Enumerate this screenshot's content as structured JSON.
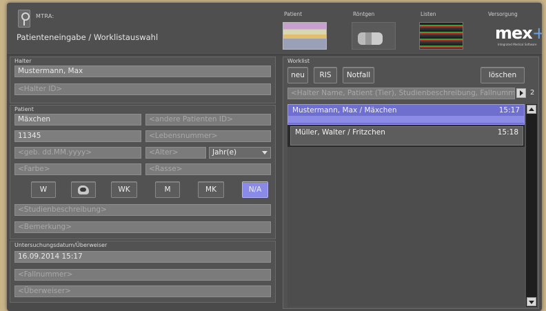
{
  "header": {
    "app_name": "MTRA:",
    "page_title": "Patienteneingabe / Worklistauswahl",
    "tabs": [
      {
        "label": "Patient",
        "icon": "patient-form-thumbnail"
      },
      {
        "label": "Röntgen",
        "icon": "xray-thumbnail"
      },
      {
        "label": "Listen",
        "icon": "list-thumbnail"
      },
      {
        "label": "Versorgung",
        "icon": "mex-logo"
      }
    ],
    "logo_text": "mex",
    "logo_plus": "+",
    "logo_tagline": "Integrated Medical Software"
  },
  "halter": {
    "title": "Halter",
    "name_value": "Mustermann, Max",
    "id_placeholder": "<Halter ID>"
  },
  "patient": {
    "title": "Patient",
    "name_value": "Mäxchen",
    "other_id_placeholder": "<andere Patienten ID>",
    "number_value": "11345",
    "lebensnummer_placeholder": "<Lebensnummer>",
    "birthdate_placeholder": "<geb. dd.MM.yyyy>",
    "age_placeholder": "<Alter>",
    "age_unit": "Jahr(e)",
    "color_placeholder": "<Farbe>",
    "breed_placeholder": "<Rasse>",
    "sex_buttons": [
      "W",
      "",
      "WK",
      "M",
      "MK",
      "N/A"
    ],
    "study_placeholder": "<Studienbeschreibung>",
    "note_placeholder": "<Bemerkung>"
  },
  "exam": {
    "title": "Untersuchungsdatum/Überweiser",
    "date_value": "16.09.2014 15:17",
    "case_placeholder": "<Fallnummer>",
    "referrer_placeholder": "<Überweiser>"
  },
  "worklist": {
    "title": "Worklist",
    "buttons": {
      "new": "neu",
      "ris": "RIS",
      "emergency": "Notfall",
      "delete": "löschen"
    },
    "filter_placeholder": "<Halter Name, Patient (Tier), Studienbeschreibung, Fallnummer>",
    "count": "2",
    "rows": [
      {
        "name": "Mustermann, Max  /  Mäxchen",
        "time": "15:17"
      },
      {
        "name": "Müller, Walter  /  Fritzchen",
        "time": "15:18"
      }
    ]
  },
  "colors": {
    "accent": "#8a8ae8",
    "selected_row": "#6f6fd0",
    "panel": "#525252",
    "field": "#7b7b7b"
  }
}
